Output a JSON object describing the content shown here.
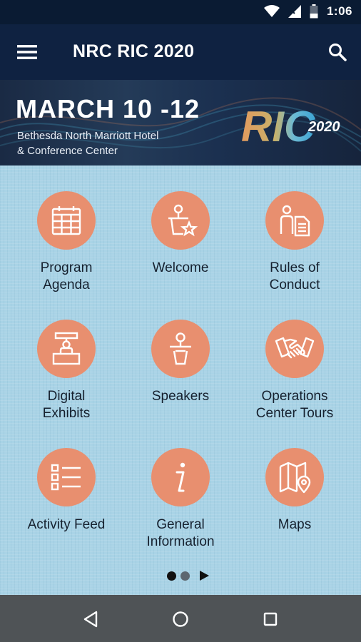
{
  "status_bar": {
    "time": "1:06"
  },
  "app_bar": {
    "title": "NRC RIC 2020"
  },
  "banner": {
    "date": "MARCH 10 -12",
    "venue_line1": "Bethesda North Marriott Hotel",
    "venue_line2": "& Conference Center",
    "logo_text": "RIC",
    "logo_year": "2020"
  },
  "tiles": [
    {
      "label_line1": "Program",
      "label_line2": "Agenda",
      "icon": "calendar-icon"
    },
    {
      "label_line1": "Welcome",
      "label_line2": "",
      "icon": "podium-star-icon"
    },
    {
      "label_line1": "Rules of",
      "label_line2": "Conduct",
      "icon": "person-document-icon"
    },
    {
      "label_line1": "Digital",
      "label_line2": "Exhibits",
      "icon": "exhibit-booth-icon"
    },
    {
      "label_line1": "Speakers",
      "label_line2": "",
      "icon": "speaker-podium-icon"
    },
    {
      "label_line1": "Operations",
      "label_line2": "Center Tours",
      "icon": "handshake-icon"
    },
    {
      "label_line1": "Activity Feed",
      "label_line2": "",
      "icon": "list-icon"
    },
    {
      "label_line1": "General",
      "label_line2": "Information",
      "icon": "info-icon"
    },
    {
      "label_line1": "Maps",
      "label_line2": "",
      "icon": "map-pin-icon"
    }
  ],
  "pager": {
    "page": 1,
    "pages": 2
  },
  "colors": {
    "app_bar": "#0f2241",
    "status_bar": "#0a1b33",
    "tile_circle": "#e88f6f",
    "grid_background": "#a9d3e6",
    "nav_bar": "#4f5356"
  }
}
